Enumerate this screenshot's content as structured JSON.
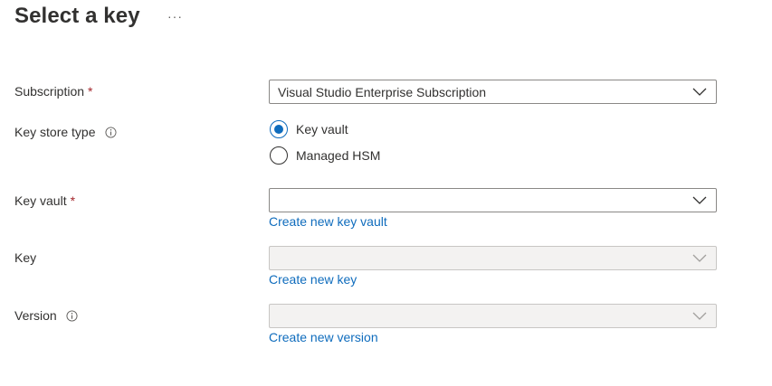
{
  "header": {
    "title": "Select a key",
    "more": "···"
  },
  "form": {
    "subscription": {
      "label": "Subscription",
      "required": "*",
      "value": "Visual Studio Enterprise Subscription"
    },
    "key_store_type": {
      "label": "Key store type",
      "options": [
        {
          "label": "Key vault",
          "checked": true
        },
        {
          "label": "Managed HSM",
          "checked": false
        }
      ]
    },
    "key_vault": {
      "label": "Key vault",
      "required": "*",
      "value": "",
      "link": "Create new key vault"
    },
    "key": {
      "label": "Key",
      "value": "",
      "link": "Create new key"
    },
    "version": {
      "label": "Version",
      "value": "",
      "link": "Create new version"
    }
  },
  "colors": {
    "accent": "#0f6cbd",
    "required": "#a4262c",
    "disabled_bg": "#f3f2f1"
  }
}
